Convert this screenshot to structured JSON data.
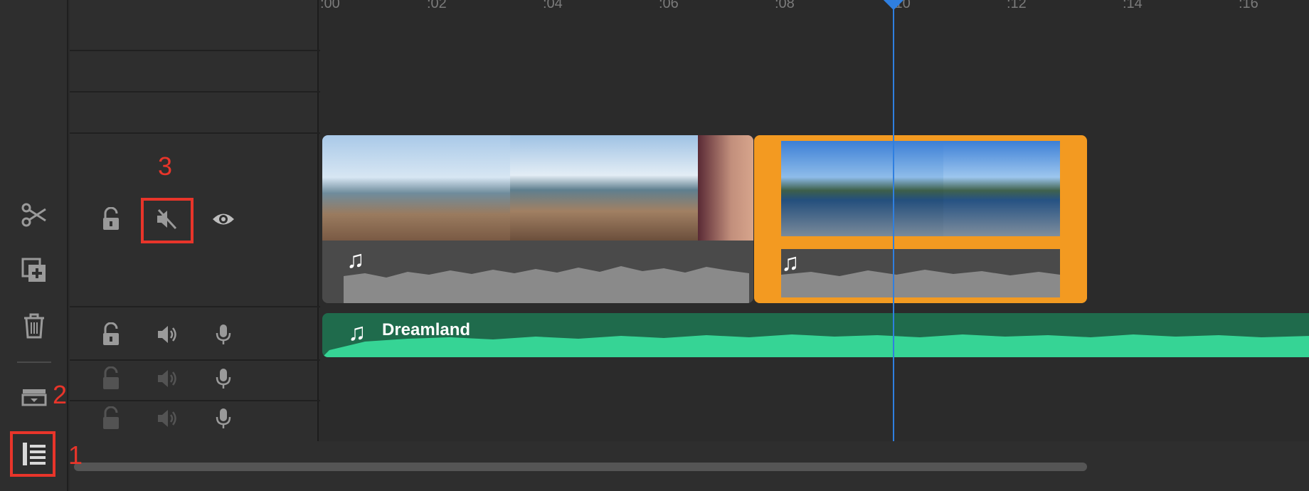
{
  "ruler": {
    "ticks": [
      ":00",
      ":02",
      ":04",
      ":06",
      ":08",
      ":10",
      ":12",
      ":14",
      ":16"
    ]
  },
  "music_clip": {
    "title": "Dreamland",
    "color": "#36d495"
  },
  "annotations": {
    "label_1": "1",
    "label_2": "2",
    "label_3": "3",
    "color": "#e8352a"
  },
  "colors": {
    "selected_clip": "#f39a21",
    "playhead": "#2f7fe0",
    "waveform": "#8a8a8a"
  },
  "left_tools": [
    "scissors-icon",
    "duplicate-icon",
    "trash-icon",
    "track-toggle-icon",
    "track-headers-icon"
  ],
  "video_track": {
    "controls": [
      "lock-icon",
      "mute-icon",
      "visibility-icon"
    ]
  },
  "audio_tracks": [
    {
      "controls": [
        "lock-icon",
        "volume-icon",
        "microphone-icon"
      ],
      "dimmed": false
    },
    {
      "controls": [
        "lock-icon",
        "volume-icon",
        "microphone-icon"
      ],
      "dimmed": true
    },
    {
      "controls": [
        "lock-icon",
        "volume-icon",
        "microphone-icon"
      ],
      "dimmed": true
    }
  ]
}
